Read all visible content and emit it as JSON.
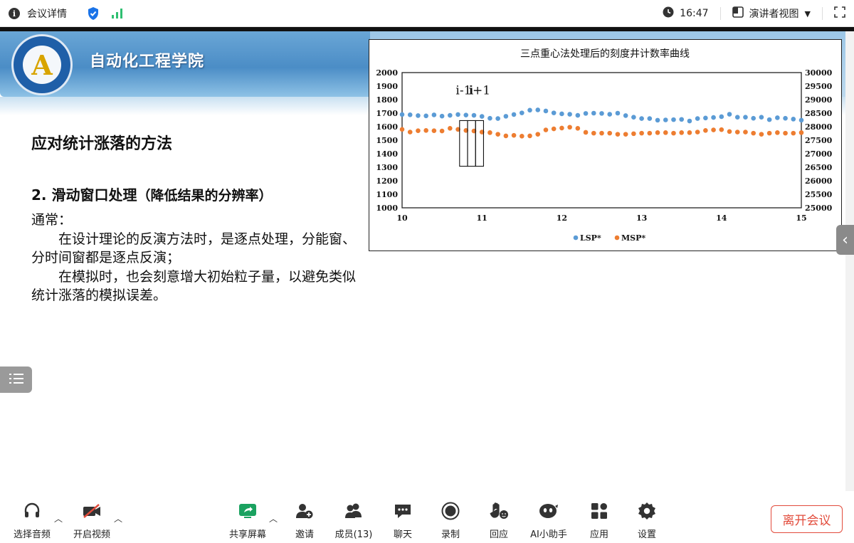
{
  "topbar": {
    "meeting_details": "会议详情",
    "time": "16:47",
    "view_mode": "演讲者视图"
  },
  "slide": {
    "school_name": "自动化工程学院",
    "logo_letter": "A",
    "heading": "应对统计涨落的方法",
    "subheading": "2.  滑动窗口处理",
    "subheading_note": "（降低结果的分辨率）",
    "body": {
      "intro": "通常：",
      "para1": "在设计理论的反演方法时，是逐点处理，分能窗、分时间窗都是逐点反演；",
      "para2": "在模拟时，也会刻意增大初始粒子量，以避免类似统计涨落的模拟误差。"
    }
  },
  "chart_data": {
    "type": "scatter",
    "title": "三点重心法处理后的刻度井计数率曲线",
    "xlabel": "",
    "ylabel": "",
    "xlim": [
      10,
      15
    ],
    "ylim": [
      1000,
      2000
    ],
    "y2lim": [
      25000,
      30000
    ],
    "x_ticks": [
      "10",
      "11",
      "12",
      "13",
      "14",
      "15"
    ],
    "y_ticks": [
      "2000",
      "1900",
      "1800",
      "1700",
      "1600",
      "1500",
      "1400",
      "1300",
      "1200",
      "1100",
      "1000"
    ],
    "y2_ticks": [
      "30000",
      "29500",
      "29000",
      "28500",
      "28000",
      "27500",
      "27000",
      "26500",
      "26000",
      "25500",
      "25000"
    ],
    "legend_position": "bottom",
    "annotations": [
      "i-1",
      "i",
      "i+1"
    ],
    "window_x": [
      10.77,
      10.87,
      10.97
    ],
    "x": [
      10.0,
      10.1,
      10.2,
      10.3,
      10.4,
      10.5,
      10.6,
      10.7,
      10.8,
      10.9,
      11.0,
      11.1,
      11.2,
      11.3,
      11.4,
      11.5,
      11.6,
      11.7,
      11.8,
      11.9,
      12.0,
      12.1,
      12.2,
      12.3,
      12.4,
      12.5,
      12.6,
      12.7,
      12.8,
      12.9,
      13.0,
      13.1,
      13.2,
      13.3,
      13.4,
      13.5,
      13.6,
      13.7,
      13.8,
      13.9,
      14.0,
      14.1,
      14.2,
      14.3,
      14.4,
      14.5,
      14.6,
      14.7,
      14.8,
      14.9,
      15.0
    ],
    "series": [
      {
        "name": "LSP*",
        "axis": "left",
        "color": "#5b9bd5",
        "values": [
          1690,
          1688,
          1682,
          1680,
          1687,
          1678,
          1684,
          1690,
          1686,
          1684,
          1676,
          1662,
          1660,
          1677,
          1690,
          1702,
          1722,
          1724,
          1716,
          1702,
          1695,
          1692,
          1684,
          1698,
          1700,
          1698,
          1692,
          1700,
          1682,
          1670,
          1660,
          1660,
          1648,
          1650,
          1652,
          1654,
          1642,
          1660,
          1664,
          1668,
          1674,
          1692,
          1670,
          1670,
          1662,
          1670,
          1652,
          1666,
          1662,
          1656,
          1648
        ]
      },
      {
        "name": "MSP*",
        "axis": "right",
        "color": "#ed7d31",
        "values": [
          27900,
          27800,
          27850,
          27860,
          27850,
          27840,
          27940,
          27900,
          27860,
          27840,
          27800,
          27780,
          27720,
          27660,
          27680,
          27650,
          27660,
          27720,
          27880,
          27920,
          27950,
          27980,
          27940,
          27790,
          27760,
          27760,
          27760,
          27720,
          27720,
          27740,
          27760,
          27760,
          27780,
          27780,
          27760,
          27780,
          27780,
          27800,
          27860,
          27880,
          27890,
          27820,
          27800,
          27800,
          27760,
          27720,
          27760,
          27780,
          27760,
          27760,
          27780
        ]
      }
    ]
  },
  "toolbar": {
    "audio": "选择音频",
    "video": "开启视频",
    "share": "共享屏幕",
    "invite": "邀请",
    "members": "成员(13)",
    "chat": "聊天",
    "record": "录制",
    "react": "回应",
    "ai": "AI小助手",
    "apps": "应用",
    "settings": "设置",
    "leave": "离开会议"
  },
  "colors": {
    "lsp": "#5b9bd5",
    "msp": "#ed7d31",
    "leave": "#e24b3b",
    "shield": "#1a73e8",
    "signal": "#2fbf71",
    "share": "#1aa260"
  }
}
